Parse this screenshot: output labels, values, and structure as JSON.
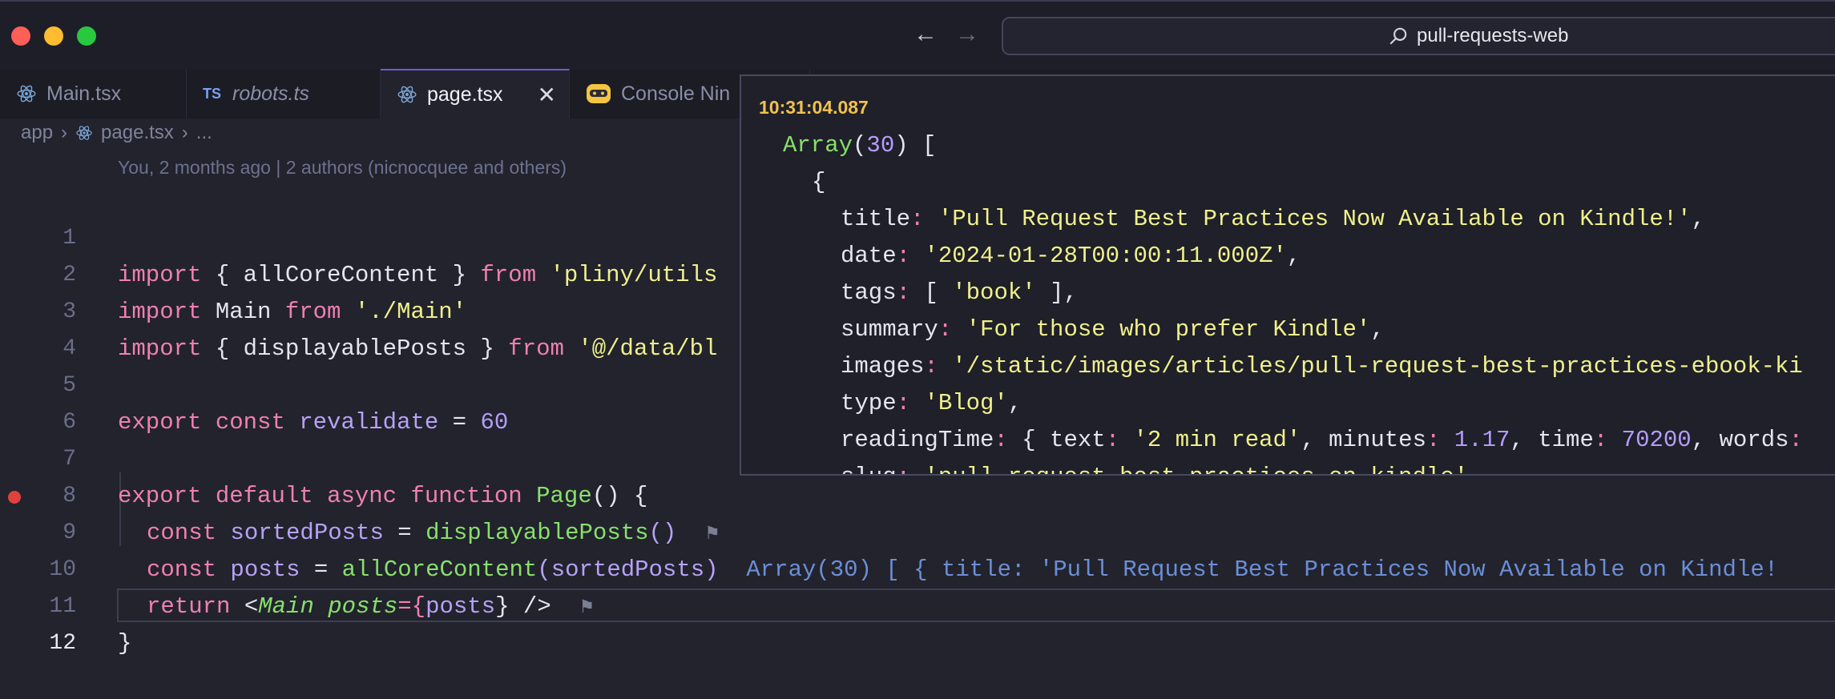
{
  "titlebar": {
    "search_text": "pull-requests-web"
  },
  "tabs": [
    {
      "label": "Main.tsx",
      "icon": "react-icon"
    },
    {
      "label": "robots.ts",
      "icon": "typescript-icon",
      "badge": "TS"
    },
    {
      "label": "page.tsx",
      "icon": "react-icon",
      "active": true
    },
    {
      "label": "Console Nin",
      "icon": "console-ninja-icon"
    }
  ],
  "breadcrumb": {
    "folder": "app",
    "file": "page.tsx",
    "rest": "..."
  },
  "blame": "You, 2 months ago | 2 authors (nicnocquee and others)",
  "editor": {
    "line_numbers": [
      "1",
      "2",
      "3",
      "4",
      "5",
      "6",
      "7",
      "8",
      "9",
      "10",
      "11",
      "12"
    ],
    "l1": {
      "a": "import",
      "b": " { allCoreContent } ",
      "c": "from",
      "d": " ",
      "e": "'pliny/utils"
    },
    "l2": {
      "a": "import",
      "b": " Main ",
      "c": "from",
      "d": " ",
      "e": "'./Main'"
    },
    "l3": {
      "a": "import",
      "b": " { displayablePosts } ",
      "c": "from",
      "d": " ",
      "e": "'@/data/bl"
    },
    "l5": {
      "a": "export",
      "b": " ",
      "c": "const",
      "d": " ",
      "e": "revalidate",
      "f": " = ",
      "g": "60"
    },
    "l7": {
      "a": "export",
      "b": " ",
      "c": "default",
      "d": " ",
      "e": "async",
      "f": " ",
      "g": "function",
      "h": " ",
      "i": "Page",
      "j": "() {"
    },
    "l8": {
      "a": "const",
      "b": " ",
      "c": "sortedPosts",
      "d": " = ",
      "e": "displayablePosts",
      "f": "()",
      "flag": "⚑"
    },
    "l9": {
      "a": "const",
      "b": " ",
      "c": "posts",
      "d": " = ",
      "e": "allCoreContent",
      "f": "(",
      "g": "sortedPosts",
      "h": ")",
      "result": "Array(30) [ { title: 'Pull Request Best Practices Now Available on Kindle!"
    },
    "l10": {
      "a": "return",
      "b": " <",
      "c": "Main",
      "d": " ",
      "e": "posts",
      "f": "={",
      "g": "posts",
      "h": "} />",
      "flag": "⚑"
    },
    "l11": {
      "a": "}"
    }
  },
  "popup": {
    "time": "10:31:04.087",
    "header": {
      "a": "Array",
      "b": "(",
      "c": "30",
      "d": ") ["
    },
    "brace": "{",
    "title": {
      "k": "title",
      "v": "'Pull Request Best Practices Now Available on Kindle!'"
    },
    "date": {
      "k": "date",
      "v": "'2024-01-28T00:00:11.000Z'"
    },
    "tags": {
      "k": "tags",
      "v": "'book'"
    },
    "summary": {
      "k": "summary",
      "v": "'For those who prefer Kindle'"
    },
    "images": {
      "k": "images",
      "v": "'/static/images/articles/pull-request-best-practices-ebook-ki"
    },
    "type": {
      "k": "type",
      "v": "'Blog'"
    },
    "readingTime": {
      "k": "readingTime",
      "text_k": "text",
      "text_v": "'2 min read'",
      "min_k": "minutes",
      "min_v": "1.17",
      "time_k": "time",
      "time_v": "70200",
      "words_k": "words"
    },
    "slug": {
      "k": "slug",
      "v": "'pull-request-best-practices-on-kindle'"
    }
  }
}
